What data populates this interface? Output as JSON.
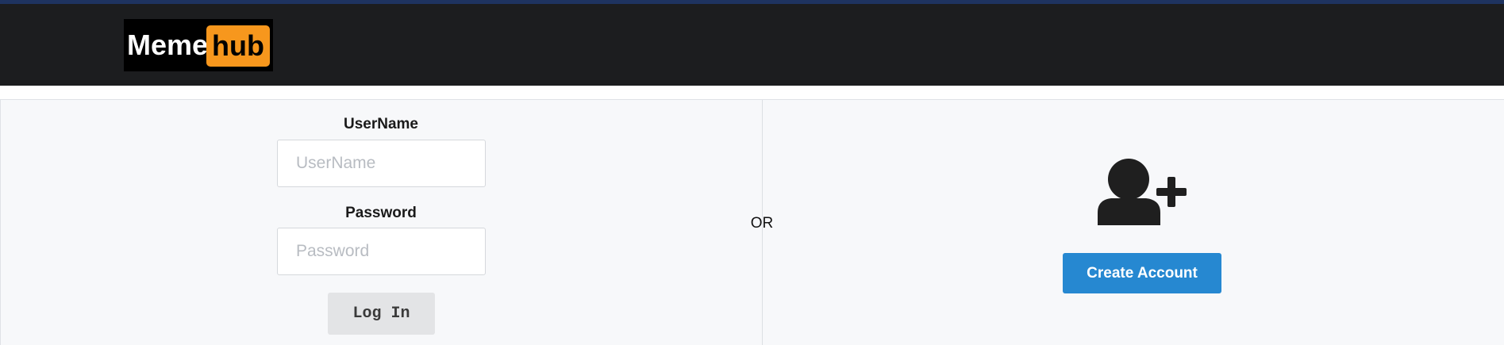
{
  "header": {
    "logo": {
      "left_text": "Meme",
      "right_text": "hub"
    }
  },
  "login": {
    "username_label": "UserName",
    "username_placeholder": "UserName",
    "username_value": "",
    "password_label": "Password",
    "password_placeholder": "Password",
    "password_value": "",
    "login_label": "Log In"
  },
  "separator": {
    "or_text": "OR"
  },
  "signup": {
    "icon": "add-user-icon",
    "create_label": "Create Account"
  },
  "colors": {
    "navbar": "#1c1d1f",
    "top_accent": "#1e3360",
    "logo_accent": "#f7971d",
    "create_button": "#2688d1",
    "panel_bg": "#f7f8fa"
  }
}
